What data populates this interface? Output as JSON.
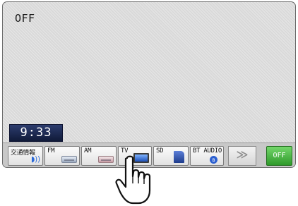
{
  "screen": {
    "status_text": "OFF",
    "clock": "9:33"
  },
  "source_bar": {
    "buttons": [
      {
        "label": "交通情報",
        "icon": "traffic-info-icon"
      },
      {
        "label": "FM",
        "icon": "fm-radio-icon"
      },
      {
        "label": "AM",
        "icon": "am-radio-icon"
      },
      {
        "label": "TV",
        "icon": "tv-icon"
      },
      {
        "label": "SD",
        "icon": "sd-card-icon"
      },
      {
        "label": "BT AUDIO",
        "icon": "bluetooth-icon"
      }
    ],
    "next_label": "≫",
    "off_label": "OFF"
  },
  "colors": {
    "off_button": "#3aaa34",
    "clock_bg": "#1b2650"
  }
}
